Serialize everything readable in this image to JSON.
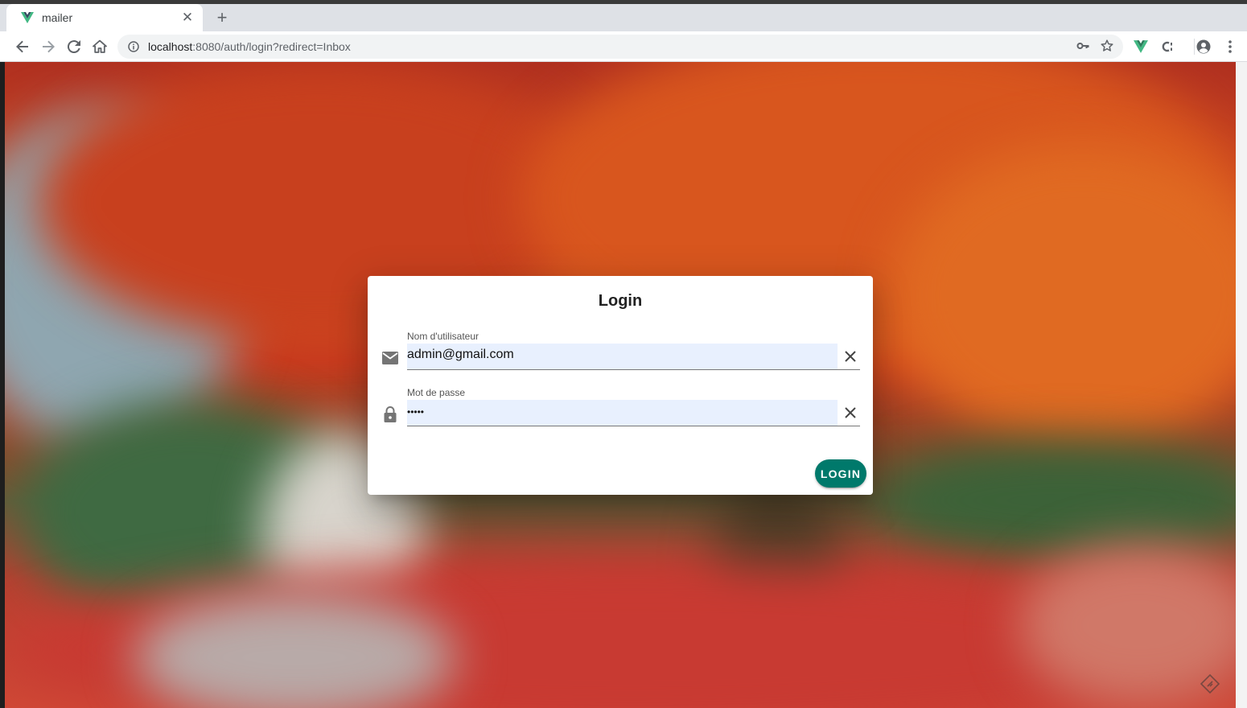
{
  "browser": {
    "tab": {
      "title": "mailer",
      "favicon": "vue-logo-icon"
    },
    "url": {
      "host": "localhost",
      "rest": ":8080/auth/login?redirect=Inbox"
    },
    "toolbar_icons": [
      "back-icon",
      "forward-icon",
      "reload-icon",
      "home-icon",
      "info-icon",
      "key-icon",
      "star-icon",
      "vue-devtools-icon",
      "extension-icon",
      "profile-icon",
      "menu-icon"
    ]
  },
  "dialog": {
    "title": "Login",
    "username": {
      "label": "Nom d'utilisateur",
      "value": "admin@gmail.com",
      "icon": "mail-icon"
    },
    "password": {
      "label": "Mot de passe",
      "value": "•••••",
      "icon": "lock-icon"
    },
    "login_label": "LOGIN"
  },
  "colors": {
    "accent": "#00796b",
    "autofill": "#e8f0fe"
  }
}
